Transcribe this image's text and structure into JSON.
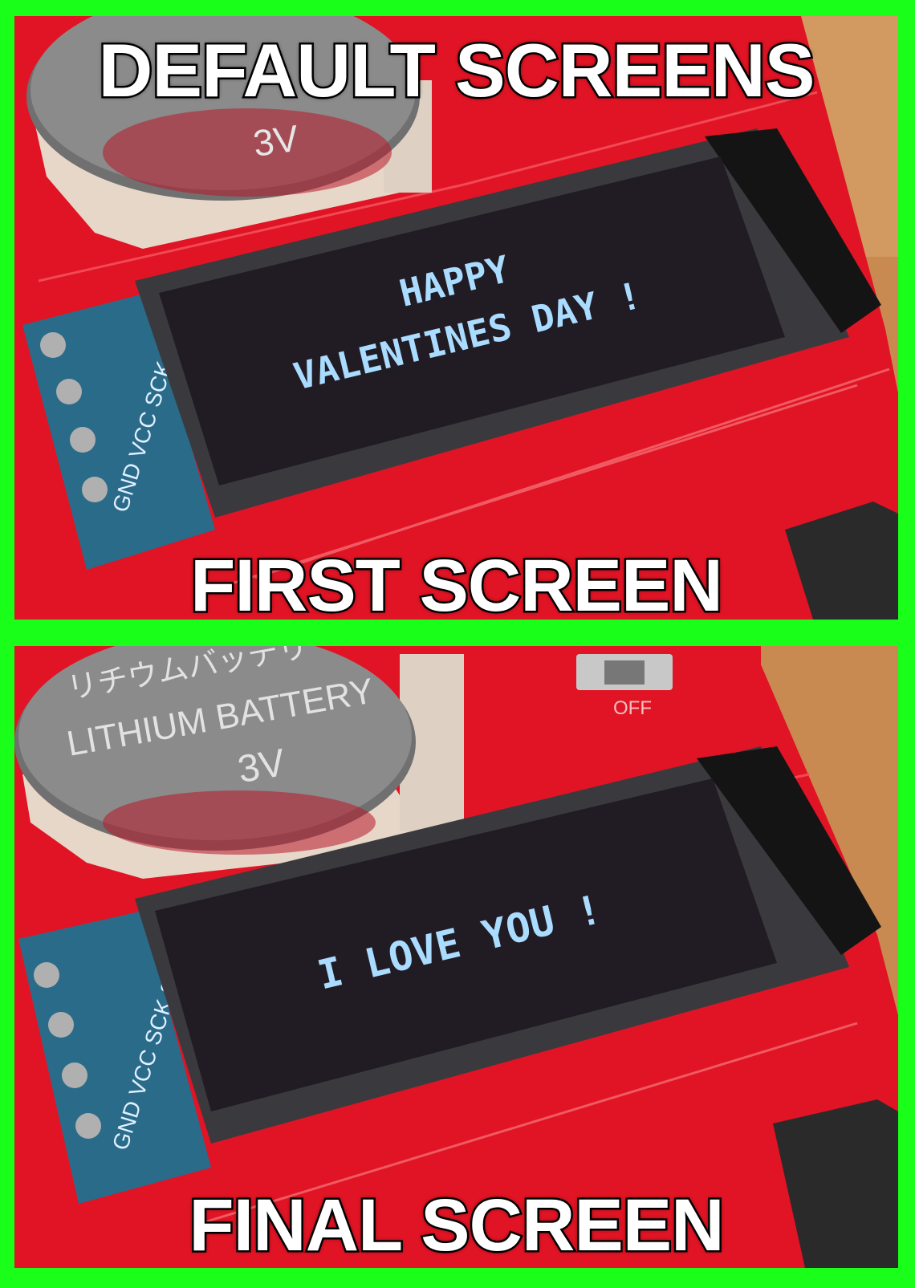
{
  "title": "DEFAULT SCREENS",
  "panels": [
    {
      "caption": "FIRST SCREEN",
      "oled_lines": [
        "HAPPY",
        "VALENTINES DAY !"
      ],
      "battery_lines": [
        "3V"
      ],
      "pin_label": "GND VCC SCK SDA"
    },
    {
      "caption": "FINAL SCREEN",
      "oled_lines": [
        "I LOVE YOU !"
      ],
      "battery_lines": [
        "リチウムバッテリー",
        "LITHIUM BATTERY",
        "3V"
      ],
      "switch_label": "OFF",
      "pin_label": "GND VCC SCK SDA"
    }
  ],
  "colors": {
    "frame": "#19ff19",
    "pcb": "#e01424",
    "oled_text": "#a9dcff"
  }
}
